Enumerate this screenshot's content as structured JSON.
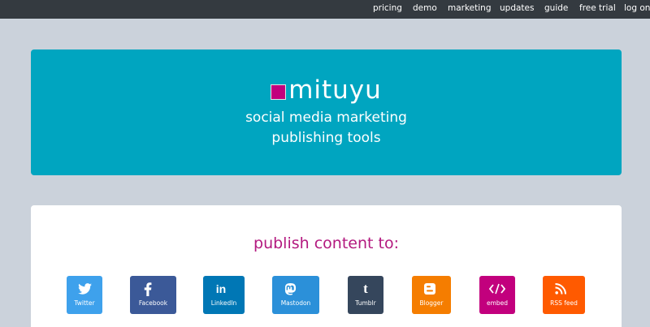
{
  "nav": {
    "items": [
      "pricing",
      "demo",
      "marketing",
      "updates",
      "guide",
      "free trial",
      "log on"
    ]
  },
  "hero": {
    "logo_text": "mituyu",
    "tagline_line1": "social media marketing",
    "tagline_line2": "publishing tools"
  },
  "publish": {
    "heading": "publish content to:",
    "destinations": [
      {
        "label": "Twitter",
        "icon": "twitter-bird-icon",
        "color": "#3ea1ec"
      },
      {
        "label": "Facebook",
        "icon": "facebook-f-icon",
        "color": "#3b5998"
      },
      {
        "label": "LinkedIn",
        "icon": "linkedin-in-icon",
        "color": "#0077b5"
      },
      {
        "label": "Mastodon",
        "icon": "mastodon-icon",
        "color": "#2b90d9"
      },
      {
        "label": "Tumblr",
        "icon": "tumblr-t-icon",
        "color": "#35465c"
      },
      {
        "label": "Blogger",
        "icon": "blogger-icon",
        "color": "#f57d00"
      },
      {
        "label": "embed",
        "icon": "code-icon",
        "color": "#c2007d"
      },
      {
        "label": "RSS feed",
        "icon": "rss-icon",
        "color": "#ff5a00"
      }
    ]
  },
  "colors": {
    "page_bg": "#cbd2db",
    "nav_bg": "#343a40",
    "hero_bg": "#00a5c0",
    "accent": "#c2007d"
  }
}
